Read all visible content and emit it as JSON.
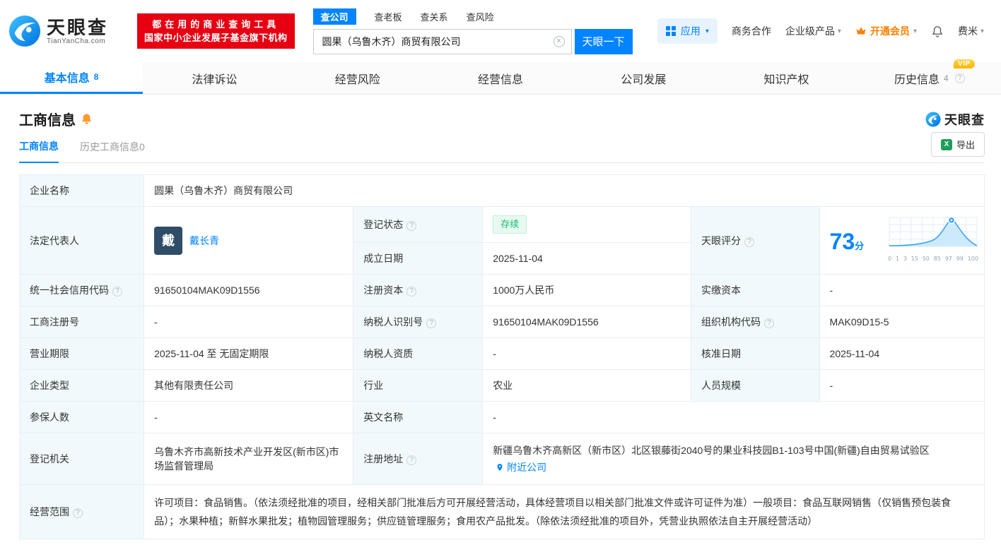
{
  "colors": {
    "primary": "#0084ff",
    "banner_red": "#e60012",
    "vip_orange": "#ff8000",
    "status_green": "#12bd6d"
  },
  "icons": {
    "help": "?",
    "caret": "▾",
    "clear": "×",
    "excel": "X"
  },
  "header": {
    "brand": "天眼查",
    "brand_sub": "TianYanCha.com",
    "banner_line1": "都在用的商业查询工具",
    "banner_line2": "国家中小企业发展子基金旗下机构",
    "search_tabs": [
      {
        "label": "查公司"
      },
      {
        "label": "查老板"
      },
      {
        "label": "查关系"
      },
      {
        "label": "查风险"
      }
    ],
    "search_value": "圆果（乌鲁木齐）商贸有限公司",
    "search_button": "天眼一下",
    "apps_label": "应用",
    "link_business": "商务合作",
    "link_enterprise": "企业级产品",
    "vip_label": "开通会员",
    "username": "费米"
  },
  "nav_tabs": [
    {
      "label": "基本信息",
      "count": "8"
    },
    {
      "label": "法律诉讼"
    },
    {
      "label": "经营风险"
    },
    {
      "label": "经营信息"
    },
    {
      "label": "公司发展"
    },
    {
      "label": "知识产权"
    },
    {
      "label": "历史信息",
      "count": "4",
      "vip_badge": "VIP"
    }
  ],
  "section": {
    "title": "工商信息",
    "watermark_brand": "天眼查",
    "subtab_active": "工商信息",
    "subtab_inactive": "历史工商信息0",
    "export_label": "导出"
  },
  "info": {
    "company_name_label": "企业名称",
    "company_name": "圆果（乌鲁木齐）商贸有限公司",
    "legal_rep_label": "法定代表人",
    "legal_rep_avatar": "戴",
    "legal_rep_name": "戴长青",
    "reg_status_label": "登记状态",
    "reg_status": "存续",
    "establish_date_label": "成立日期",
    "establish_date": "2025-11-04",
    "score_label": "天眼评分",
    "score_value": "73",
    "score_unit": "分",
    "score_axis": [
      "0",
      "1",
      "3",
      "15",
      "50",
      "85",
      "97",
      "99",
      "100"
    ],
    "credit_code_label": "统一社会信用代码",
    "credit_code": "91650104MAK09D1556",
    "reg_capital_label": "注册资本",
    "reg_capital": "1000万人民币",
    "paid_capital_label": "实缴资本",
    "paid_capital": "-",
    "reg_number_label": "工商注册号",
    "reg_number": "-",
    "taxpayer_id_label": "纳税人识别号",
    "taxpayer_id": "91650104MAK09D1556",
    "org_code_label": "组织机构代码",
    "org_code": "MAK09D15-5",
    "business_term_label": "营业期限",
    "business_term": "2025-11-04 至 无固定期限",
    "taxpayer_quality_label": "纳税人资质",
    "taxpayer_quality": "-",
    "approval_date_label": "核准日期",
    "approval_date": "2025-11-04",
    "company_type_label": "企业类型",
    "company_type": "其他有限责任公司",
    "industry_label": "行业",
    "industry": "农业",
    "staff_size_label": "人员规模",
    "staff_size": "-",
    "insured_label": "参保人数",
    "insured": "-",
    "english_name_label": "英文名称",
    "english_name": "-",
    "reg_authority_label": "登记机关",
    "reg_authority": "乌鲁木齐市高新技术产业开发区(新市区)市场监督管理局",
    "address_label": "注册地址",
    "address": "新疆乌鲁木齐高新区（新市区）北区银藤街2040号的果业科技园B1-103号中国(新疆)自由贸易试验区",
    "nearby_link": "附近公司",
    "business_scope_label": "经营范围",
    "business_scope": "许可项目：食品销售。（依法须经批准的项目，经相关部门批准后方可开展经营活动，具体经营项目以相关部门批准文件或许可证件为准）一般项目：食品互联网销售（仅销售预包装食品）；水果种植；新鲜水果批发；植物园管理服务；供应链管理服务；食用农产品批发。（除依法须经批准的项目外，凭营业执照依法自主开展经营活动）"
  }
}
